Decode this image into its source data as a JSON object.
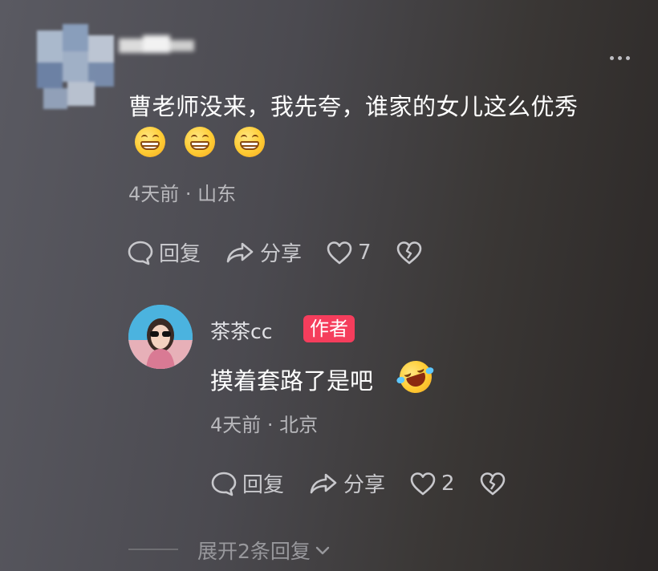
{
  "comment": {
    "text": "曹老师没来，我先夸，谁家的女儿这么优秀",
    "emojis": [
      "grinning-face",
      "grinning-face",
      "grinning-face"
    ],
    "meta": "4天前 · 山东",
    "actions": {
      "reply": "回复",
      "share": "分享",
      "likes": "7"
    }
  },
  "reply": {
    "name": "茶茶cc",
    "badge": "作者",
    "text": "摸着套路了是吧",
    "emoji": "rolling-laughing-face",
    "meta": "4天前 · 北京",
    "actions": {
      "reply": "回复",
      "share": "分享",
      "likes": "2"
    }
  },
  "expand": {
    "label": "展开2条回复"
  },
  "colors": {
    "badge": "#f53d5c",
    "action": "#c8c8cc",
    "meta": "#b8b8bc"
  }
}
